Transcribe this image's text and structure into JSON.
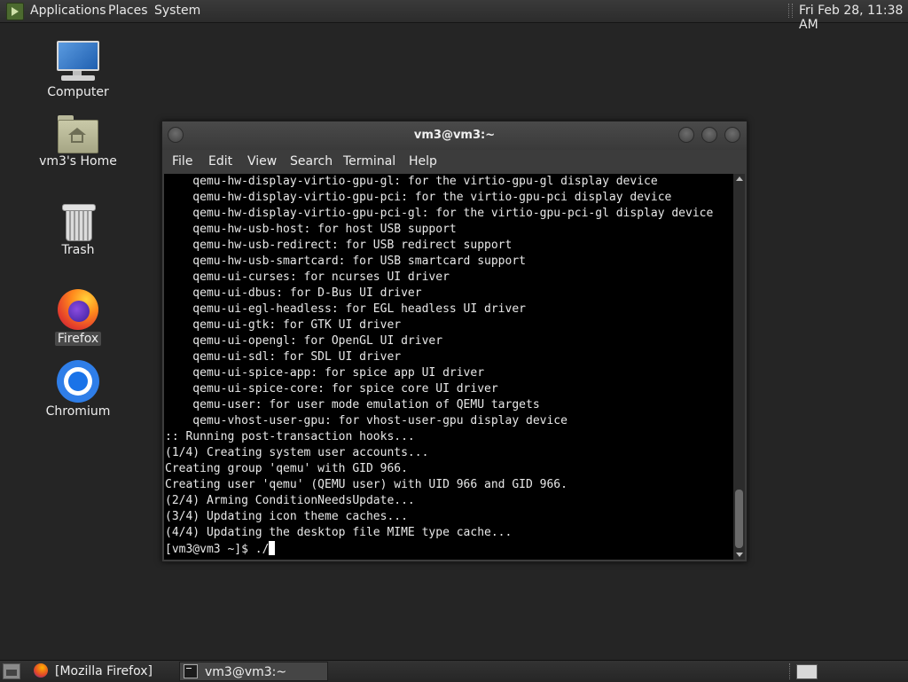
{
  "top_panel": {
    "menus": [
      "Applications",
      "Places",
      "System"
    ],
    "clock": "Fri Feb 28, 11:38 AM"
  },
  "desktop": {
    "icons": [
      {
        "label": "Computer",
        "icon": "computer-icon"
      },
      {
        "label": "vm3's Home",
        "icon": "home-folder-icon"
      },
      {
        "label": "Trash",
        "icon": "trash-icon"
      },
      {
        "label": "Firefox",
        "icon": "firefox-icon",
        "selected": true
      },
      {
        "label": "Chromium",
        "icon": "chromium-icon"
      }
    ]
  },
  "terminal": {
    "title": "vm3@vm3:~",
    "menu": [
      "File",
      "Edit",
      "View",
      "Search",
      "Terminal",
      "Help"
    ],
    "lines": [
      "    qemu-hw-display-virtio-gpu-gl: for the virtio-gpu-gl display device",
      "    qemu-hw-display-virtio-gpu-pci: for the virtio-gpu-pci display device",
      "    qemu-hw-display-virtio-gpu-pci-gl: for the virtio-gpu-pci-gl display device",
      "    qemu-hw-usb-host: for host USB support",
      "    qemu-hw-usb-redirect: for USB redirect support",
      "    qemu-hw-usb-smartcard: for USB smartcard support",
      "    qemu-ui-curses: for ncurses UI driver",
      "    qemu-ui-dbus: for D-Bus UI driver",
      "    qemu-ui-egl-headless: for EGL headless UI driver",
      "    qemu-ui-gtk: for GTK UI driver",
      "    qemu-ui-opengl: for OpenGL UI driver",
      "    qemu-ui-sdl: for SDL UI driver",
      "    qemu-ui-spice-app: for spice app UI driver",
      "    qemu-ui-spice-core: for spice core UI driver",
      "    qemu-user: for user mode emulation of QEMU targets",
      "    qemu-vhost-user-gpu: for vhost-user-gpu display device",
      ":: Running post-transaction hooks...",
      "(1/4) Creating system user accounts...",
      "Creating group 'qemu' with GID 966.",
      "Creating user 'qemu' (QEMU user) with UID 966 and GID 966.",
      "(2/4) Arming ConditionNeedsUpdate...",
      "(3/4) Updating icon theme caches...",
      "(4/4) Updating the desktop file MIME type cache..."
    ],
    "prompt": "[vm3@vm3 ~]$ ./"
  },
  "taskbar": {
    "tasks": [
      {
        "label": "[Mozilla Firefox]",
        "icon": "firefox-icon"
      },
      {
        "label": "vm3@vm3:~",
        "icon": "terminal-icon",
        "active": true
      }
    ]
  }
}
